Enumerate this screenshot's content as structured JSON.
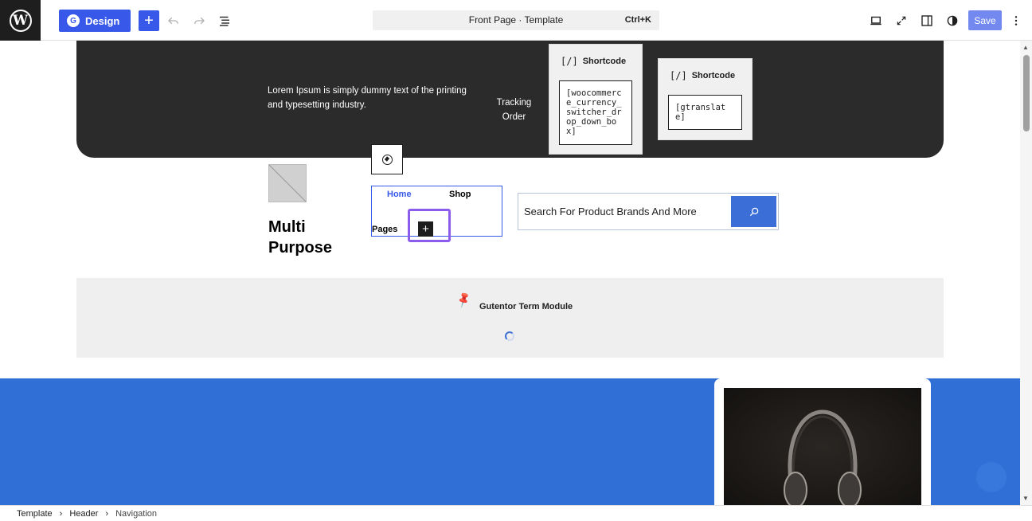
{
  "toolbar": {
    "design_label": "Design",
    "document_title": "Front Page · Template",
    "shortcut": "Ctrl+K",
    "save_label": "Save",
    "icons": {
      "logo": "wordpress-icon",
      "add": "plus-icon",
      "undo": "undo-icon",
      "redo": "redo-icon",
      "list_view": "list-view-icon",
      "desktop": "desktop-icon",
      "fullscreen": "fullscreen-icon",
      "sidebar": "sidebar-icon",
      "styles": "contrast-icon",
      "options": "more-vertical-icon"
    },
    "accent_color": "#3858e9"
  },
  "hero": {
    "lorem": "Lorem Ipsum is simply dummy text of the printing and typesetting industry.",
    "tracking": "Tracking Order",
    "background_color": "#2b2b2b"
  },
  "shortcodes": [
    {
      "label": "Shortcode",
      "icon": "[/]",
      "value": "[woocommerce_currency_switcher_drop_down_box]"
    },
    {
      "label": "Shortcode",
      "icon": "[/]",
      "value": "[gtranslate]"
    }
  ],
  "header": {
    "site_title": "Multi Purpose",
    "nav": {
      "items": [
        "Home",
        "Shop",
        "Pages"
      ],
      "active": "Home"
    },
    "search": {
      "placeholder": "Search For Product Brands And More"
    }
  },
  "term_module": {
    "label": "Gutentor Term Module"
  },
  "sections": {
    "blue_color": "#3070d6"
  },
  "breadcrumb": [
    "Template",
    "Header",
    "Navigation"
  ]
}
